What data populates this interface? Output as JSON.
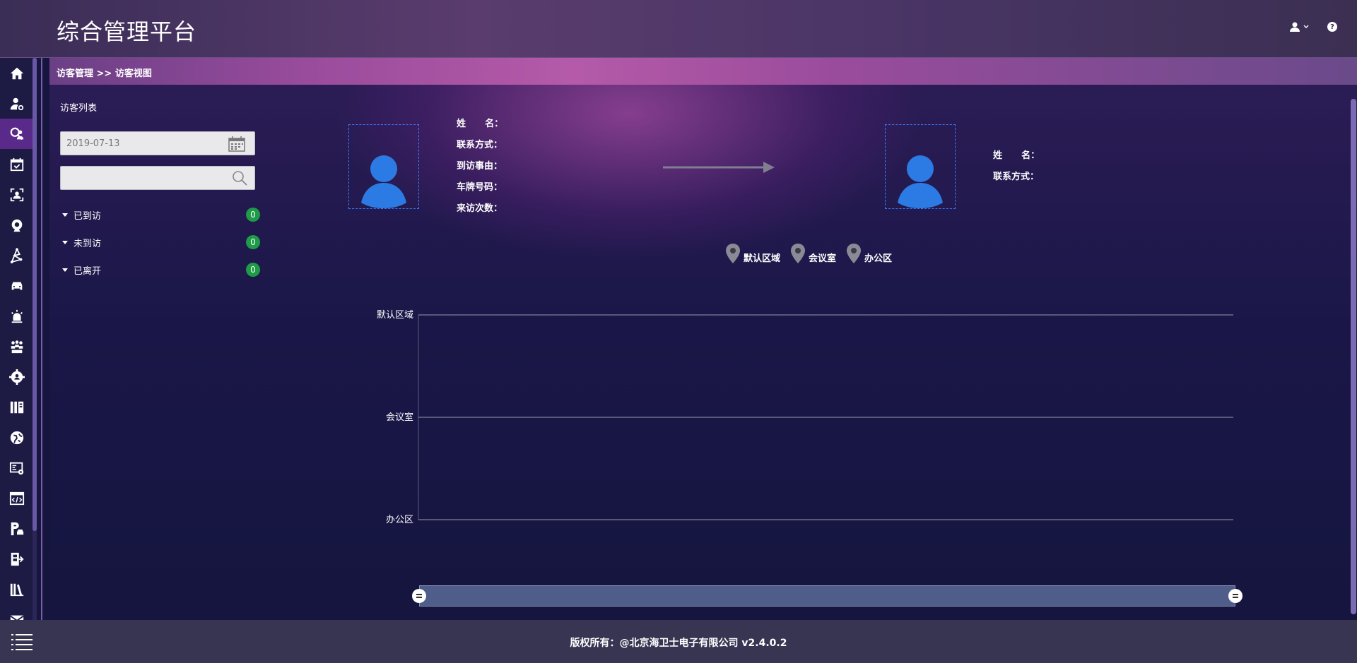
{
  "header": {
    "title": "综合管理平台",
    "user_icon": "user-icon",
    "help_icon": "help-icon",
    "help_glyph": "?"
  },
  "sidebar": {
    "items": [
      {
        "icon": "home-icon"
      },
      {
        "icon": "user-settings-icon"
      },
      {
        "icon": "visitor-icon",
        "active": true
      },
      {
        "icon": "calendar-check-icon"
      },
      {
        "icon": "face-scan-icon"
      },
      {
        "icon": "camera-icon"
      },
      {
        "icon": "network-icon"
      },
      {
        "icon": "car-icon"
      },
      {
        "icon": "alarm-icon"
      },
      {
        "icon": "group-icon"
      },
      {
        "icon": "gear-person-icon"
      },
      {
        "icon": "cabinet-icon"
      },
      {
        "icon": "globe-icon"
      },
      {
        "icon": "terminal-settings-icon"
      },
      {
        "icon": "code-window-icon"
      },
      {
        "icon": "parking-icon"
      },
      {
        "icon": "door-icon"
      },
      {
        "icon": "library-icon"
      },
      {
        "icon": "mail-icon"
      }
    ]
  },
  "breadcrumb": "访客管理 >> 访客视图",
  "visitor_list": {
    "title": "访客列表",
    "date_value": "2019-07-13",
    "search_placeholder": "",
    "groups": [
      {
        "label": "已到访",
        "count": "0"
      },
      {
        "label": "未到访",
        "count": "0"
      },
      {
        "label": "已离开",
        "count": "0"
      }
    ]
  },
  "visitor_info": {
    "fields": [
      "姓      名：",
      "联系方式：",
      "到访事由：",
      "车牌号码：",
      "来访次数："
    ]
  },
  "host_info": {
    "fields": [
      "姓      名：",
      "联系方式："
    ]
  },
  "legend": [
    "默认区域",
    "会议室",
    "办公区"
  ],
  "timeline": {
    "rows": [
      "默认区域",
      "会议室",
      "办公区"
    ]
  },
  "colors": {
    "accent": "#3a7bff",
    "badge": "#1e9b47",
    "active_nav": "#5a2a8a"
  },
  "footer": {
    "copyright": "版权所有：@北京海卫士电子有限公司 v2.4.0.2",
    "menu_icon": "list-menu-icon"
  }
}
